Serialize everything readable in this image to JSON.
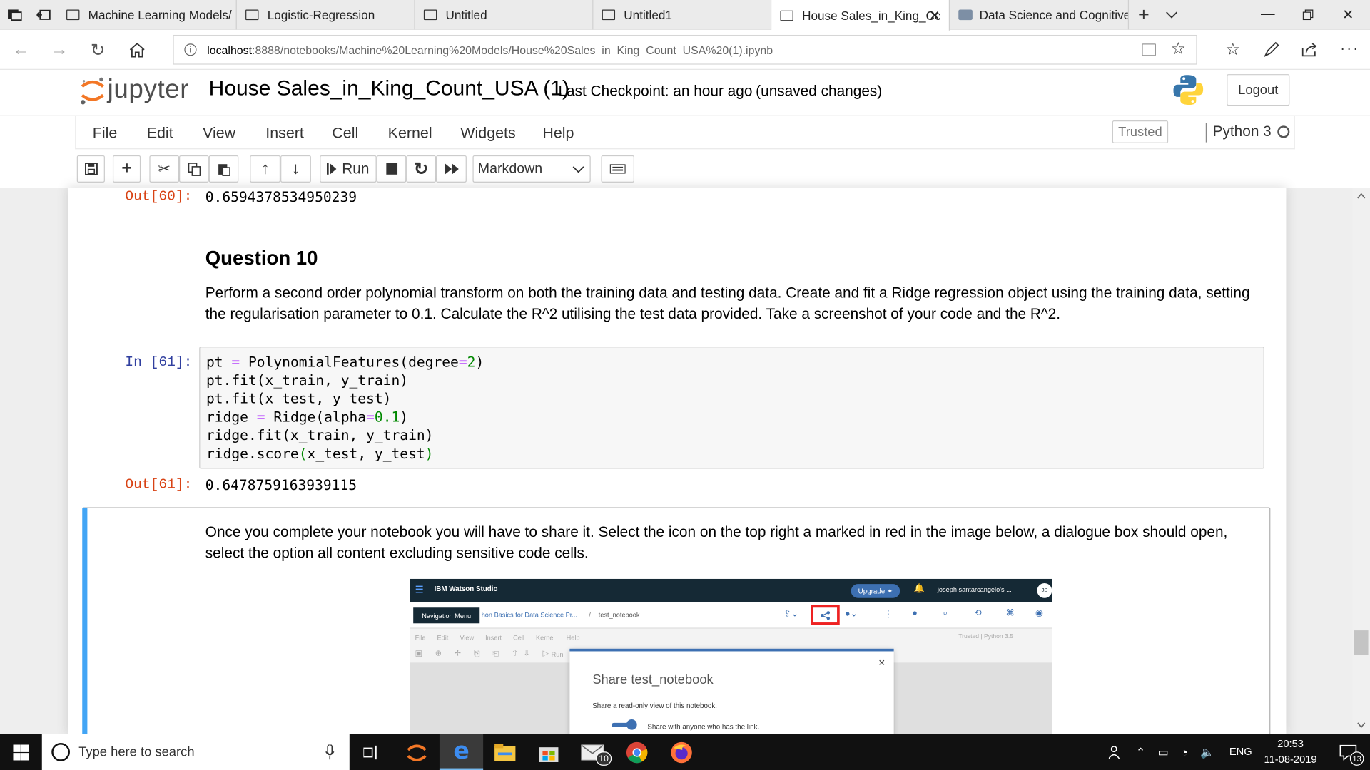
{
  "browser": {
    "tabs": [
      {
        "title": "Machine Learning Models/"
      },
      {
        "title": "Logistic-Regression"
      },
      {
        "title": "Untitled"
      },
      {
        "title": "Untitled1"
      },
      {
        "title": "House Sales_in_King_Cc",
        "active": true
      },
      {
        "title": "Data Science and Cognitive"
      }
    ],
    "url_host": "localhost",
    "url_path": ":8888/notebooks/Machine%20Learning%20Models/House%20Sales_in_King_Count_USA%20(1).ipynb"
  },
  "jupyter": {
    "logo_text": "jupyter",
    "notebook_name": "House Sales_in_King_Count_USA (1)",
    "checkpoint": "Last Checkpoint: an hour ago",
    "unsaved": "(unsaved changes)",
    "logout": "Logout",
    "menus": [
      "File",
      "Edit",
      "View",
      "Insert",
      "Cell",
      "Kernel",
      "Widgets",
      "Help"
    ],
    "trusted": "Trusted",
    "kernel_name": "Python 3",
    "run_label": "Run",
    "cell_type": "Markdown"
  },
  "cells": {
    "out60_prompt": "Out[60]:",
    "out60_value": "0.6594378534950239",
    "q10_heading": "Question 10",
    "q10_text": "Perform a second order polynomial transform on both the training data and testing data. Create and fit a Ridge regression object using the training data, setting the regularisation parameter to 0.1. Calculate the R^2 utilising the test data provided. Take a screenshot of your code and the R^2.",
    "in61_prompt": "In [61]:",
    "code_lines": [
      "pt = PolynomialFeatures(degree=2)",
      "pt.fit(x_train, y_train)",
      "pt.fit(x_test, y_test)",
      "ridge = Ridge(alpha=0.1)",
      "ridge.fit(x_train, y_train)",
      "ridge.score(x_test, y_test)"
    ],
    "out61_prompt": "Out[61]:",
    "out61_value": "0.6478759163939115",
    "share_text": "Once you complete your notebook you will have to share it. Select the icon on the top right a marked in red in the image below, a dialogue box should open, select the option all content excluding sensitive code cells."
  },
  "embedded": {
    "brand": "IBM Watson Studio",
    "upgrade": "Upgrade",
    "user": "joseph santarcangelo's ...",
    "avatar": "JS",
    "tooltip": "Navigation Menu",
    "breadcrumb_project": "hon Basics for Data Science Pr...",
    "breadcrumb_sep": "/",
    "breadcrumb_notebook": "test_notebook",
    "menus": [
      "File",
      "Edit",
      "View",
      "Insert",
      "Cell",
      "Kernel",
      "Help"
    ],
    "trusted_kernel": "Trusted | Python 3.5",
    "run": "Run",
    "dialog_title": "Share test_notebook",
    "dialog_desc": "Share a read-only view of this notebook.",
    "dialog_toggle": "Share with anyone who has the link.",
    "close": "×"
  },
  "taskbar": {
    "search_placeholder": "Type here to search",
    "mail_badge": "10",
    "lang": "ENG",
    "time": "20:53",
    "date": "11-08-2019",
    "notif_count": "13"
  },
  "colors": {
    "in_prompt": "#303f9f",
    "out_prompt": "#d84315",
    "selected_cell": "#42a5f5",
    "code_bg": "#f7f7f7",
    "keyword_op": "#aa22ff",
    "number": "#008800",
    "taskbar": "#111111",
    "jupyter_orange": "#f37726"
  }
}
